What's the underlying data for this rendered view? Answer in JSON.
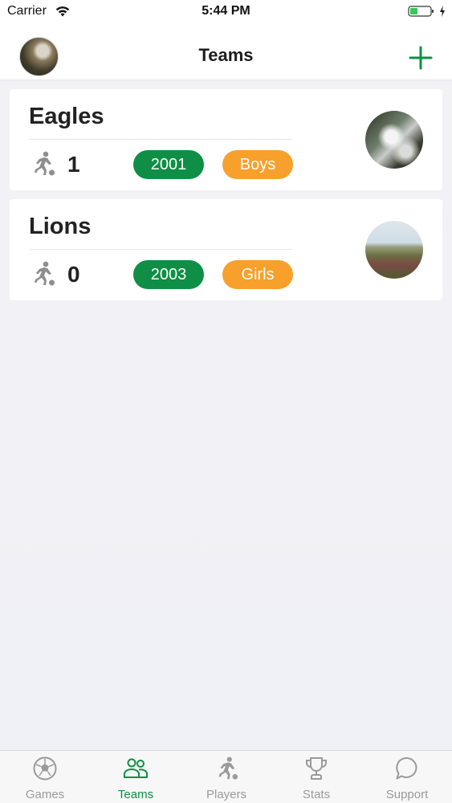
{
  "status_bar": {
    "carrier": "Carrier",
    "time": "5:44 PM"
  },
  "nav": {
    "title": "Teams",
    "accent_color": "#0e8f45"
  },
  "teams": [
    {
      "name": "Eagles",
      "players": "1",
      "year": "2001",
      "gender": "Boys"
    },
    {
      "name": "Lions",
      "players": "0",
      "year": "2003",
      "gender": "Girls"
    }
  ],
  "colors": {
    "year_badge": "#0e8f45",
    "gender_badge": "#f7a02b",
    "tab_active": "#0e8f45",
    "tab_inactive": "#9a9a9a"
  },
  "tab_bar": {
    "items": [
      {
        "label": "Games",
        "icon": "soccer-ball-icon",
        "active": false
      },
      {
        "label": "Teams",
        "icon": "people-icon",
        "active": true
      },
      {
        "label": "Players",
        "icon": "player-kicking-icon",
        "active": false
      },
      {
        "label": "Stats",
        "icon": "trophy-icon",
        "active": false
      },
      {
        "label": "Support",
        "icon": "chat-bubble-icon",
        "active": false
      }
    ]
  }
}
